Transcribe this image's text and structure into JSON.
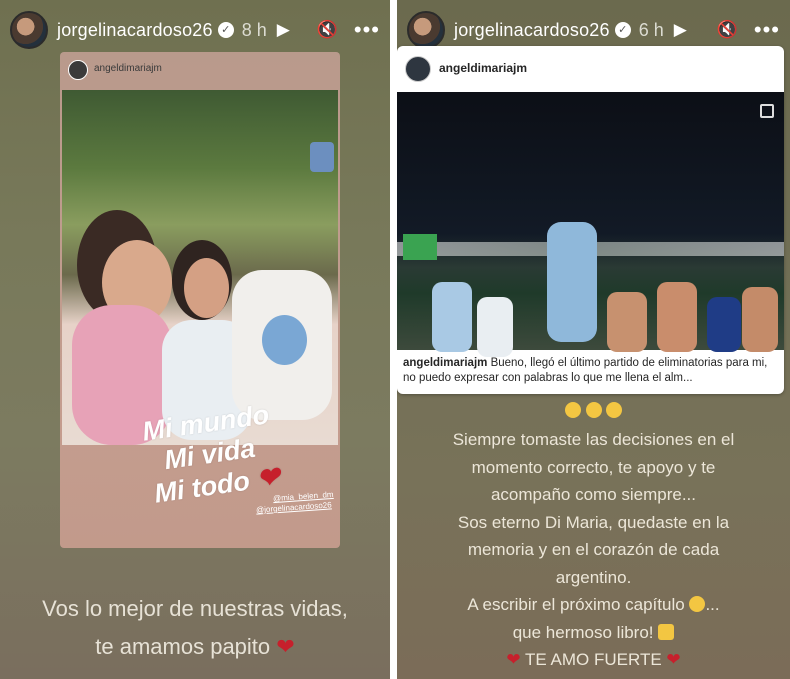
{
  "story_left": {
    "username": "jorgelinacardoso26",
    "time": "8 h",
    "card": {
      "username": "angeldimariajm",
      "overlay_lines": [
        "Mi mundo",
        "Mi vida",
        "Mi todo"
      ],
      "tag1": "@mia_belen_dm",
      "tag2": "@jorgelinacardoso26"
    },
    "caption_line1": "Vos lo mejor de nuestras vidas,",
    "caption_line2": "te amamos papito"
  },
  "story_right": {
    "username": "jorgelinacardoso26",
    "time": "6 h",
    "card": {
      "username": "angeldimariajm",
      "caption_user": "angeldimariajm",
      "caption_text": "Bueno, llegó el último partido de eliminatorias para mi, no puedo expresar con palabras lo que me llena el alm..."
    },
    "message_lines": [
      "Siempre tomaste las decisiones en el",
      "momento correcto, te apoyo y te",
      "acompaño como siempre...",
      "Sos eterno Di Maria, quedaste en la",
      "memoria y en el corazón de cada",
      "argentino.",
      "A escribir el próximo capítulo",
      "que hermoso libro!",
      "TE AMO FUERTE"
    ]
  },
  "icons": {
    "verified": "verified-badge-icon",
    "play": "play-icon",
    "mute": "mute-icon",
    "more": "more-icon",
    "carousel": "carousel-icon",
    "heart": "red-heart-icon"
  },
  "colors": {
    "heart": "#c6202c",
    "card_white": "#ffffff"
  }
}
